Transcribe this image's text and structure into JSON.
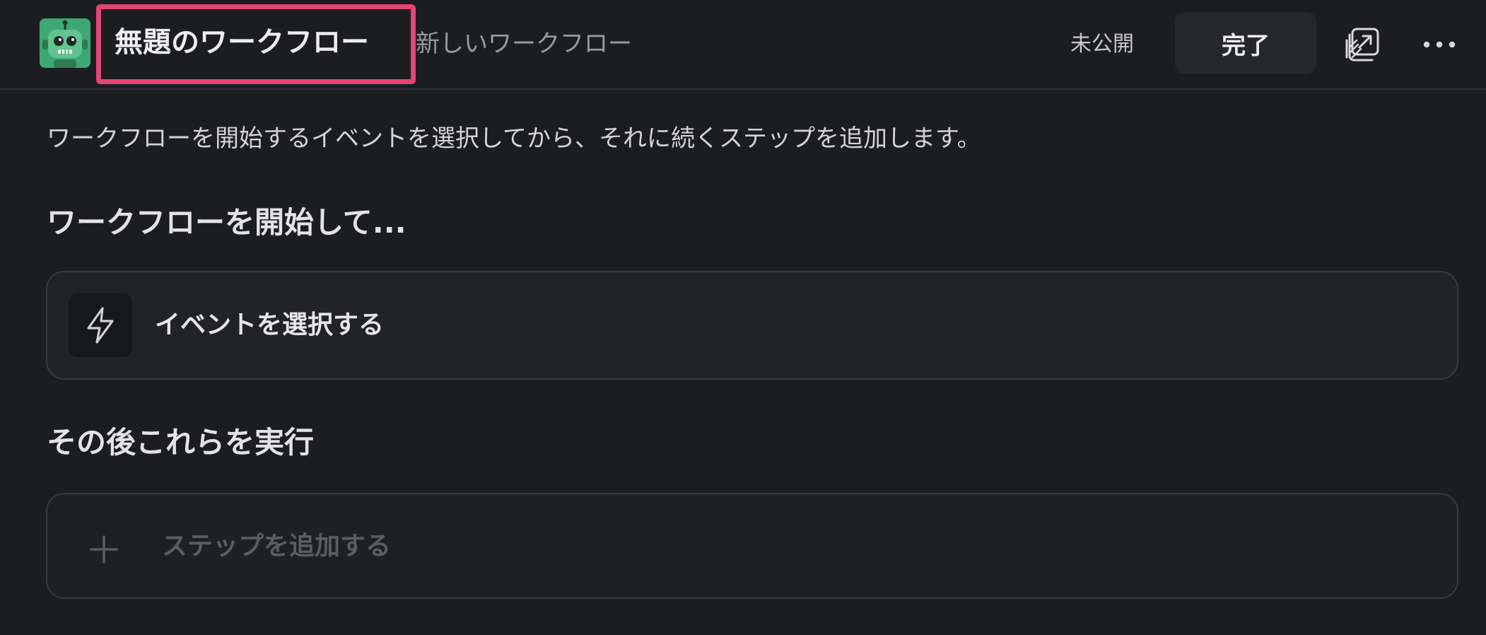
{
  "header": {
    "title": "無題のワークフロー",
    "subtitle": "新しいワークフロー",
    "status": "未公開",
    "done_label": "完了",
    "icons": [
      "bot-avatar-icon",
      "share-window-icon",
      "more-horizontal-icon"
    ]
  },
  "description": "ワークフローを開始するイベントを選択してから、それに続くステップを追加します。",
  "start_section": {
    "heading": "ワークフローを開始して...",
    "event_label": "イベントを選択する",
    "icon": "lightning-bolt-icon"
  },
  "then_section": {
    "heading": "その後これらを実行",
    "step_label": "ステップを追加する",
    "icon": "plus-icon"
  },
  "colors": {
    "background": "#1c1d21",
    "highlight": "#e34676",
    "avatar": "#3ea872"
  }
}
